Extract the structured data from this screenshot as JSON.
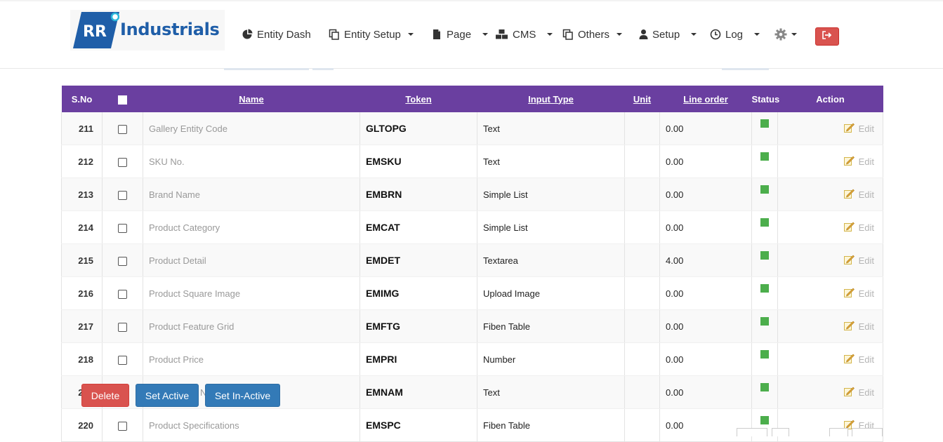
{
  "brand": {
    "name": "Industrials",
    "mark": "RR",
    "colors": {
      "primary": "#1f5ea8",
      "accent": "#2bb7da"
    }
  },
  "nav": {
    "items": [
      {
        "label": "Entity Dash",
        "icon": "pie-chart-icon",
        "caret": false
      },
      {
        "label": "Entity Setup",
        "icon": "copy-icon",
        "caret": true
      },
      {
        "label": "Page",
        "icon": "file-icon",
        "caret": true
      },
      {
        "label": "CMS",
        "icon": "cubes-icon",
        "caret": true
      },
      {
        "label": "Others",
        "icon": "copy-icon",
        "caret": true
      },
      {
        "label": "Setup",
        "icon": "user-icon",
        "caret": true
      },
      {
        "label": "Log",
        "icon": "clock-icon",
        "caret": true
      }
    ],
    "settings_icon": "gear-icon",
    "logout_icon": "sign-out-icon",
    "logout_color": "#d9534f"
  },
  "table": {
    "header_color": "#6a3fa0",
    "columns": {
      "sno": "S.No",
      "name": "Name",
      "token": "Token",
      "input_type": "Input Type",
      "unit": "Unit",
      "line_order": "Line order",
      "status": "Status",
      "action": "Action"
    },
    "rows": [
      {
        "sno": "211",
        "name": "Gallery Entity Code",
        "token": "GLTOPG",
        "input_type": "Text",
        "unit": "",
        "line_order": "0.00",
        "action": "Edit"
      },
      {
        "sno": "212",
        "name": "SKU No.",
        "token": "EMSKU",
        "input_type": "Text",
        "unit": "",
        "line_order": "0.00",
        "action": "Edit"
      },
      {
        "sno": "213",
        "name": "Brand Name",
        "token": "EMBRN",
        "input_type": "Simple List",
        "unit": "",
        "line_order": "0.00",
        "action": "Edit"
      },
      {
        "sno": "214",
        "name": "Product Category",
        "token": "EMCAT",
        "input_type": "Simple List",
        "unit": "",
        "line_order": "0.00",
        "action": "Edit"
      },
      {
        "sno": "215",
        "name": "Product Detail",
        "token": "EMDET",
        "input_type": "Textarea",
        "unit": "",
        "line_order": "4.00",
        "action": "Edit"
      },
      {
        "sno": "216",
        "name": "Product Square Image",
        "token": "EMIMG",
        "input_type": "Upload Image",
        "unit": "",
        "line_order": "0.00",
        "action": "Edit"
      },
      {
        "sno": "217",
        "name": "Product Feature Grid",
        "token": "EMFTG",
        "input_type": "Fiben Table",
        "unit": "",
        "line_order": "0.00",
        "action": "Edit"
      },
      {
        "sno": "218",
        "name": "Product Price",
        "token": "EMPRI",
        "input_type": "Number",
        "unit": "",
        "line_order": "0.00",
        "action": "Edit"
      },
      {
        "sno": "219",
        "name": "Product Full Name",
        "token": "EMNAM",
        "input_type": "Text",
        "unit": "",
        "line_order": "0.00",
        "action": "Edit"
      },
      {
        "sno": "220",
        "name": "Product Specifications",
        "token": "EMSPC",
        "input_type": "Fiben Table",
        "unit": "",
        "line_order": "0.00",
        "action": "Edit"
      }
    ],
    "status_color": "#4cae4c"
  },
  "actions": {
    "delete_label": "Delete",
    "set_active_label": "Set Active",
    "set_inactive_label": "Set In-Active"
  }
}
